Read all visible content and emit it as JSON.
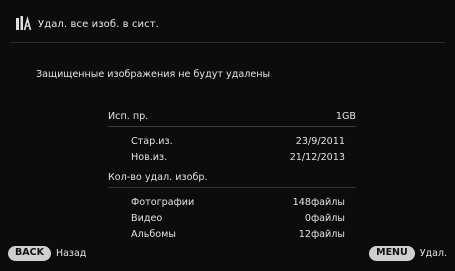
{
  "header": {
    "icon": "trash-icon",
    "title": "Удал. все изоб. в сист."
  },
  "warning": "Защищенные изображения не будут удалены",
  "info": {
    "used_space": {
      "label": "Исп. пр.",
      "value": "1GB"
    },
    "old_date": {
      "label": "Стар.из.",
      "value": "23/9/2011"
    },
    "new_date": {
      "label": "Нов.из.",
      "value": "21/12/2013"
    },
    "delete_count_heading": "Кол-во удал. изобр.",
    "photos": {
      "label": "Фотографии",
      "value": "148файлы"
    },
    "video": {
      "label": "Видео",
      "value": "0файлы"
    },
    "albums": {
      "label": "Альбомы",
      "value": "12файлы"
    }
  },
  "footer": {
    "back_key": "BACK",
    "back_label": "Назад",
    "menu_key": "MENU",
    "menu_label": "Удал."
  }
}
